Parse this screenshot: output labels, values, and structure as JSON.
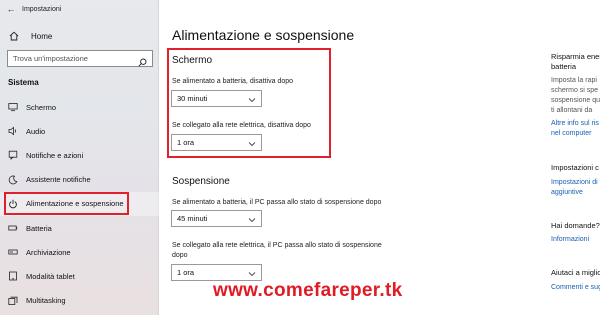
{
  "window": {
    "title": "Impostazioni"
  },
  "sidebar": {
    "home_label": "Home",
    "search_placeholder": "Trova un'impostazione",
    "section_label": "Sistema",
    "items": [
      {
        "label": "Schermo",
        "icon": "monitor-icon"
      },
      {
        "label": "Audio",
        "icon": "speaker-icon"
      },
      {
        "label": "Notifiche e azioni",
        "icon": "notification-icon"
      },
      {
        "label": "Assistente notifiche",
        "icon": "moon-icon"
      },
      {
        "label": "Alimentazione e sospensione",
        "icon": "power-icon",
        "selected": true
      },
      {
        "label": "Batteria",
        "icon": "battery-icon"
      },
      {
        "label": "Archiviazione",
        "icon": "storage-icon"
      },
      {
        "label": "Modalità tablet",
        "icon": "tablet-icon"
      },
      {
        "label": "Multitasking",
        "icon": "multitasking-icon"
      }
    ]
  },
  "main": {
    "title": "Alimentazione e sospensione",
    "screen": {
      "title": "Schermo",
      "battery_label": "Se alimentato a batteria, disattiva dopo",
      "battery_value": "30 minuti",
      "plugged_label": "Se collegato alla rete elettrica, disattiva dopo",
      "plugged_value": "1 ora"
    },
    "sleep": {
      "title": "Sospensione",
      "battery_label": "Se alimentato a batteria, il PC passa allo stato di sospensione dopo",
      "battery_value": "45 minuti",
      "plugged_label_line1": "Se collegato alla rete elettrica, il PC passa allo stato di sospensione",
      "plugged_label_line2": "dopo",
      "plugged_value": "1 ora"
    }
  },
  "right_panel": {
    "save_title_line1": "Risparmia ener",
    "save_title_line2": "batteria",
    "save_text_lines": [
      "Imposta la rapi",
      "schermo si spe",
      "sospensione qu",
      "ti allontani da"
    ],
    "save_link_line1": "Altre info sul ris",
    "save_link_line2": "nel computer",
    "related_title": "Impostazioni c",
    "related_link_line1": "Impostazioni di",
    "related_link_line2": "aggiuntive",
    "question_title": "Hai domande?",
    "question_link": "Informazioni",
    "help_title": "Aiutaci a miglio",
    "help_link": "Commenti e sug"
  },
  "watermark": "www.comefareper.tk",
  "colors": {
    "highlight": "#e0202a",
    "link": "#1a5fb4",
    "watermark": "#e01b24"
  }
}
